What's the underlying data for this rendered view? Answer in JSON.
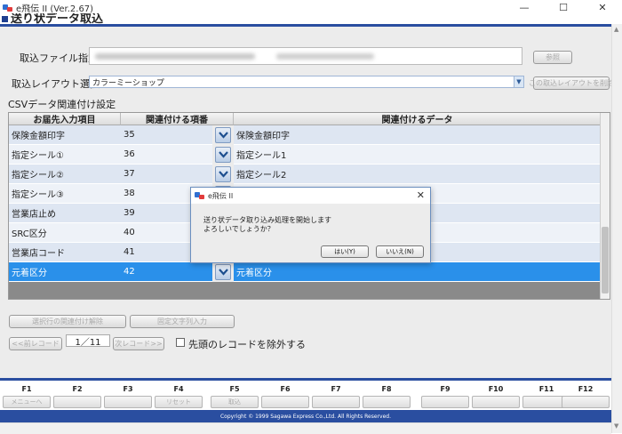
{
  "window": {
    "title": "e飛伝 II (Ver.2.67)",
    "minimize": "—",
    "maximize": "☐",
    "close": "✕"
  },
  "header": {
    "title": "送り状データ取込"
  },
  "form": {
    "import_file_label": "取込ファイル指定",
    "browse_label": "参照",
    "layout_label": "取込レイアウト選択",
    "layout_value": "カラーミーショップ",
    "delete_layout_label": "この取込レイアウトを削除",
    "csv_section_label": "CSVデータ関連付け設定"
  },
  "grid": {
    "headers": [
      "お届先入力項目",
      "関連付ける項番",
      "関連付けるデータ"
    ],
    "rows": [
      {
        "field": "保険金額印字",
        "number": "35",
        "data": "保険金額印字",
        "has_button": true
      },
      {
        "field": "指定シール①",
        "number": "36",
        "data": "指定シール1",
        "has_button": true
      },
      {
        "field": "指定シール②",
        "number": "37",
        "data": "指定シール2",
        "has_button": true
      },
      {
        "field": "指定シール③",
        "number": "38",
        "data": "",
        "has_button": false
      },
      {
        "field": "営業店止め",
        "number": "39",
        "data": "",
        "has_button": false
      },
      {
        "field": "SRC区分",
        "number": "40",
        "data": "",
        "has_button": false
      },
      {
        "field": "営業店コード",
        "number": "41",
        "data": "",
        "has_button": false
      },
      {
        "field": "元着区分",
        "number": "42",
        "data": "元着区分",
        "has_button": true,
        "selected": true
      }
    ]
  },
  "actions": {
    "clear_link_label": "選択行の関連付け解除",
    "fixed_string_label": "固定文字列入力"
  },
  "nav": {
    "prev_label": "<<前レコード",
    "record_label": "1／11",
    "next_label": "次レコード>>",
    "exclude_label": "先頭のレコードを除外する"
  },
  "fkeys": [
    {
      "key": "F1",
      "label": "メニューへ"
    },
    {
      "key": "F2",
      "label": ""
    },
    {
      "key": "F3",
      "label": ""
    },
    {
      "key": "F4",
      "label": "リセット"
    },
    {
      "key": "F5",
      "label": "取込"
    },
    {
      "key": "F6",
      "label": ""
    },
    {
      "key": "F7",
      "label": ""
    },
    {
      "key": "F8",
      "label": ""
    },
    {
      "key": "F9",
      "label": ""
    },
    {
      "key": "F10",
      "label": ""
    },
    {
      "key": "F11",
      "label": ""
    },
    {
      "key": "F12",
      "label": ""
    }
  ],
  "copyright": "Copyright © 1999 Sagawa Express Co.,Ltd. All Rights Reserved.",
  "dialog": {
    "title": "e飛伝 II",
    "close": "✕",
    "message_line1": "送り状データ取り込み処理を開始します",
    "message_line2": "よろしいでしょうか？",
    "yes_label": "はい(Y)",
    "no_label": "いいえ(N)"
  }
}
